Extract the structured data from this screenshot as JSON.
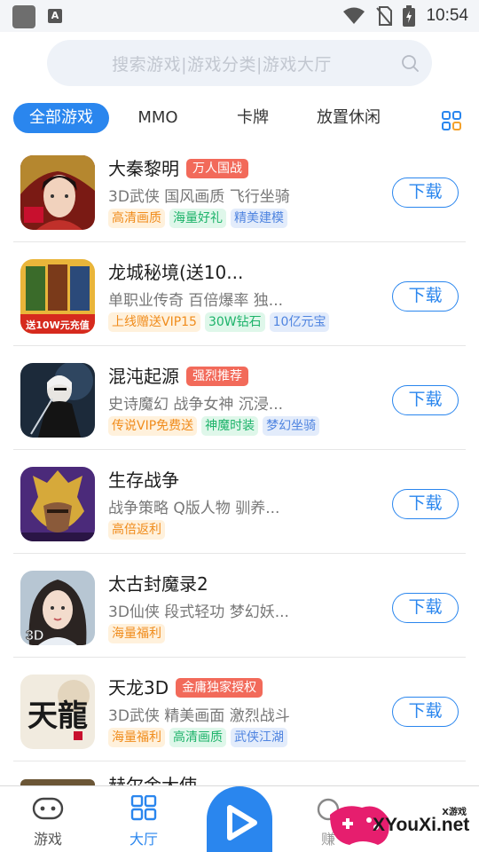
{
  "status_bar": {
    "time": "10:54",
    "icons": [
      "app-square-icon",
      "a-notification-icon",
      "wifi-icon",
      "no-sim-icon",
      "battery-charging-icon"
    ]
  },
  "search": {
    "placeholder": "搜索游戏|游戏分类|游戏大厅",
    "icon": "search-icon"
  },
  "tabs": [
    {
      "label": "全部游戏",
      "active": true
    },
    {
      "label": "MMO",
      "active": false
    },
    {
      "label": "卡牌",
      "active": false
    },
    {
      "label": "放置休闲",
      "active": false
    }
  ],
  "games": [
    {
      "name": "大秦黎明",
      "badge": "万人国战",
      "desc": "3D武侠 国风画质 飞行坐骑",
      "tags": [
        {
          "text": "高清画质",
          "color": "orange"
        },
        {
          "text": "海量好礼",
          "color": "green"
        },
        {
          "text": "精美建模",
          "color": "blue"
        }
      ],
      "button": "下载",
      "icon": "queen-warrior-icon"
    },
    {
      "name": "龙城秘境(送10...",
      "badge": "",
      "desc": "单职业传奇 百倍爆率 独...",
      "tags": [
        {
          "text": "上线赠送VIP15",
          "color": "orange"
        },
        {
          "text": "30W钻石",
          "color": "green"
        },
        {
          "text": "10亿元宝",
          "color": "blue"
        }
      ],
      "button": "下载",
      "icon": "gold-cards-icon",
      "icon_caption": "送10W元充值"
    },
    {
      "name": "混沌起源",
      "badge": "强烈推荐",
      "desc": "史诗魔幻 战争女神 沉浸...",
      "tags": [
        {
          "text": "传说VIP免费送",
          "color": "orange"
        },
        {
          "text": "神魔时装",
          "color": "green"
        },
        {
          "text": "梦幻坐骑",
          "color": "blue"
        }
      ],
      "button": "下载",
      "icon": "android-swordswoman-icon"
    },
    {
      "name": "生存战争",
      "badge": "",
      "desc": "战争策略 Q版人物 驯养...",
      "tags": [
        {
          "text": "高倍返利",
          "color": "orange"
        }
      ],
      "button": "下载",
      "icon": "helmet-knight-icon"
    },
    {
      "name": "太古封魔录2",
      "badge": "",
      "desc": "3D仙侠 段式轻功 梦幻妖...",
      "tags": [
        {
          "text": "海量福利",
          "color": "orange"
        }
      ],
      "button": "下载",
      "icon": "fairy-portrait-icon",
      "icon_caption": "3D"
    },
    {
      "name": "天龙3D",
      "badge": "金庸独家授权",
      "desc": "3D武侠 精美画面 激烈战斗",
      "tags": [
        {
          "text": "海量福利",
          "color": "orange"
        },
        {
          "text": "高清画质",
          "color": "green"
        },
        {
          "text": "武侠江湖",
          "color": "blue"
        }
      ],
      "button": "下载",
      "icon": "calligraphy-tianlong-icon",
      "icon_caption": "天龍"
    }
  ],
  "partial_game": {
    "name": "赫尔金大使"
  },
  "bottom_nav": [
    {
      "label": "游戏",
      "icon": "gamepad-icon",
      "active": false
    },
    {
      "label": "大厅",
      "icon": "grid-icon",
      "active": true
    },
    {
      "label": "",
      "icon": "play-icon",
      "active": false
    },
    {
      "label": "赚",
      "icon": "coin-bag-icon",
      "active": false
    }
  ],
  "watermark": {
    "small": "X游戏",
    "main": "XYouXi.net"
  },
  "colors": {
    "accent": "#2a86ee",
    "badge": "#f26a5a"
  }
}
